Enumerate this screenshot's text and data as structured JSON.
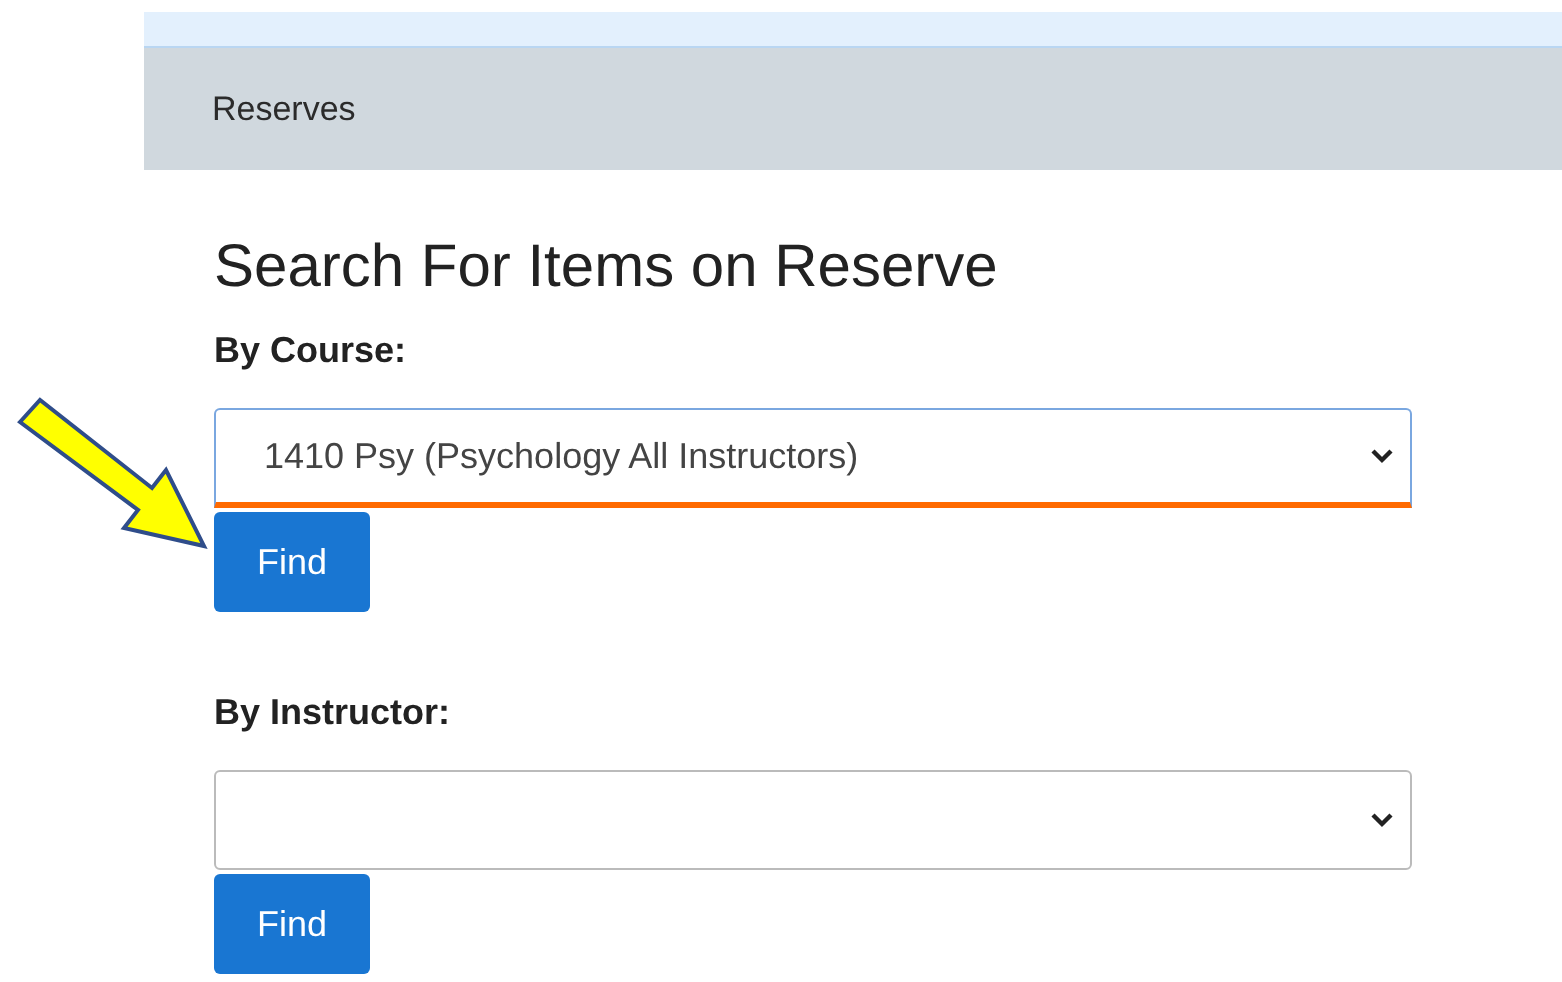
{
  "breadcrumb": "Reserves",
  "title": "Search For Items on Reserve",
  "searches": [
    {
      "label": "By Course:",
      "value": "1410 Psy (Psychology All Instructors)",
      "focused": true,
      "button": "Find"
    },
    {
      "label": "By Instructor:",
      "focused": false,
      "button": "Find"
    }
  ]
}
